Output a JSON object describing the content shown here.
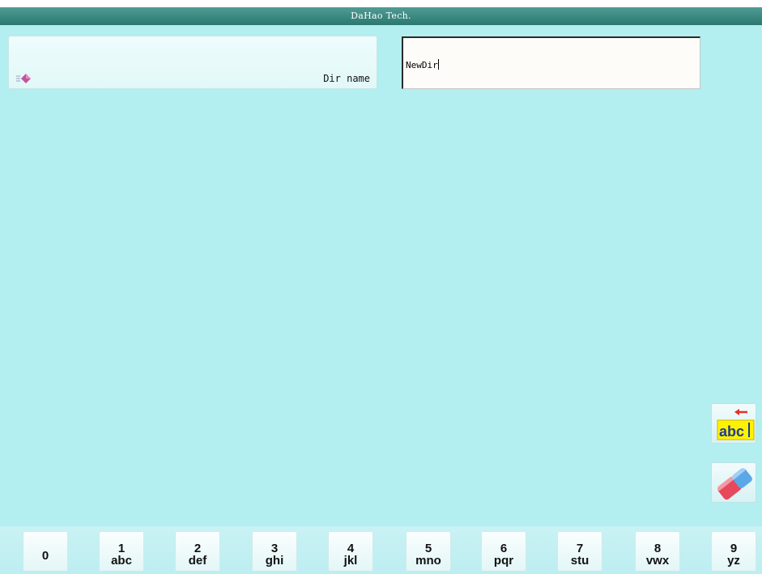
{
  "window": {
    "title": "DaHao Tech."
  },
  "form": {
    "label": "Dir name",
    "input_value": "NewDir",
    "bullet_icon": "pink-diamond-bullet-icon"
  },
  "side_buttons": [
    {
      "name": "backspace-button",
      "icon": "backspace-abc-icon",
      "icon_text": "abc"
    },
    {
      "name": "clear-button",
      "icon": "eraser-icon"
    }
  ],
  "keypad": {
    "keys": [
      {
        "digit": "0",
        "letters": ""
      },
      {
        "digit": "1",
        "letters": "abc"
      },
      {
        "digit": "2",
        "letters": "def"
      },
      {
        "digit": "3",
        "letters": "ghi"
      },
      {
        "digit": "4",
        "letters": "jkl"
      },
      {
        "digit": "5",
        "letters": "mno"
      },
      {
        "digit": "6",
        "letters": "pqr"
      },
      {
        "digit": "7",
        "letters": "stu"
      },
      {
        "digit": "8",
        "letters": "vwx"
      },
      {
        "digit": "9",
        "letters": "yz"
      }
    ]
  },
  "colors": {
    "background": "#b3eef0",
    "title_bar": "#2b7870",
    "backspace_icon_bg": "#fff200",
    "backspace_arrow": "#e53020",
    "eraser_red": "#e8485c",
    "eraser_blue": "#5aa8e8"
  }
}
